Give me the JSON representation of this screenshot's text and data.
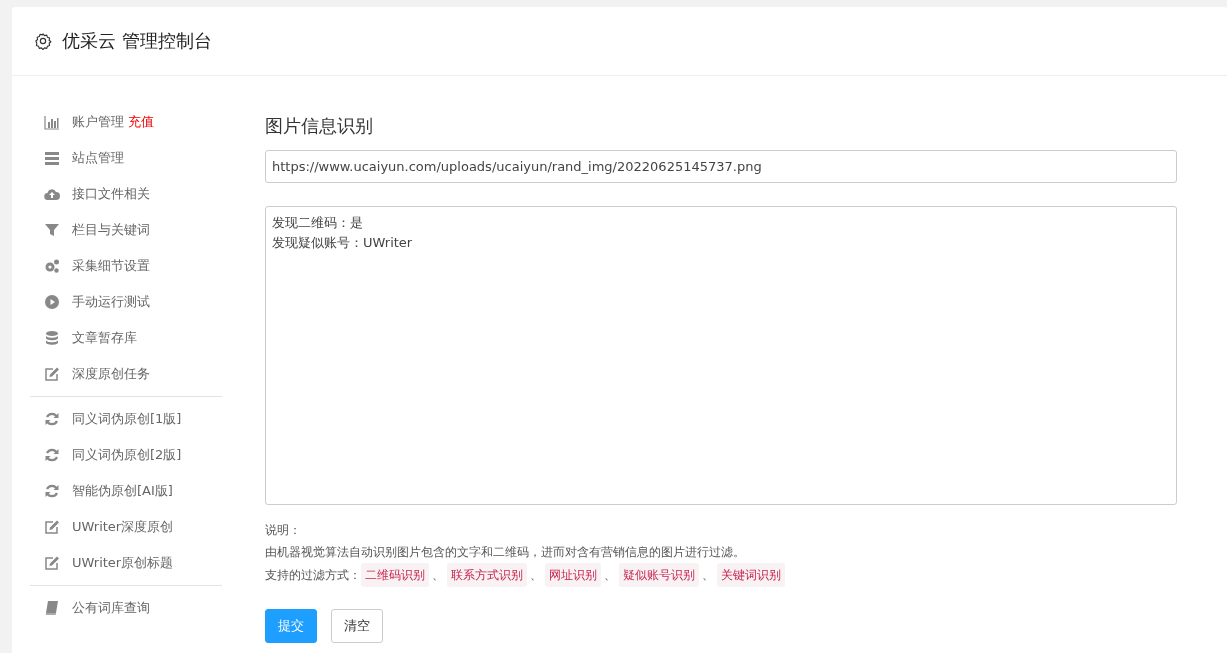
{
  "header": {
    "title": "优采云 管理控制台"
  },
  "sidebar": {
    "groups": [
      {
        "items": [
          {
            "label": "账户管理",
            "badge": "充值",
            "kind": "chart"
          },
          {
            "label": "站点管理",
            "kind": "server"
          },
          {
            "label": "接口文件相关",
            "kind": "cloud"
          },
          {
            "label": "栏目与关键词",
            "kind": "filter"
          },
          {
            "label": "采集细节设置",
            "kind": "gears"
          },
          {
            "label": "手动运行测试",
            "kind": "play"
          },
          {
            "label": "文章暂存库",
            "kind": "database"
          },
          {
            "label": "深度原创任务",
            "kind": "edit"
          }
        ]
      },
      {
        "items": [
          {
            "label": "同义词伪原创[1版]",
            "kind": "refresh"
          },
          {
            "label": "同义词伪原创[2版]",
            "kind": "refresh"
          },
          {
            "label": "智能伪原创[AI版]",
            "kind": "refresh"
          },
          {
            "label": "UWriter深度原创",
            "kind": "edit"
          },
          {
            "label": "UWriter原创标题",
            "kind": "edit"
          }
        ]
      },
      {
        "items": [
          {
            "label": "公有词库查询",
            "kind": "book"
          }
        ]
      }
    ]
  },
  "main": {
    "heading": "图片信息识别",
    "url_field": {
      "value": "https://www.ucaiyun.com/uploads/ucaiyun/rand_img/20220625145737.png"
    },
    "result_box": {
      "lines": [
        "发现二维码：是",
        "发现疑似账号：UWriter"
      ]
    },
    "notes": {
      "title": "说明：",
      "description": "由机器视觉算法自动识别图片包含的文字和二维码，进而对含有营销信息的图片进行过滤。",
      "methods_label": "支持的过滤方式：",
      "methods": [
        "二维码识别",
        "联系方式识别",
        "网址识别",
        "疑似账号识别",
        "关键词识别"
      ],
      "separator": "、"
    },
    "buttons": [
      {
        "label": "提交",
        "kind": "primary"
      },
      {
        "label": "清空",
        "kind": "default"
      }
    ]
  }
}
